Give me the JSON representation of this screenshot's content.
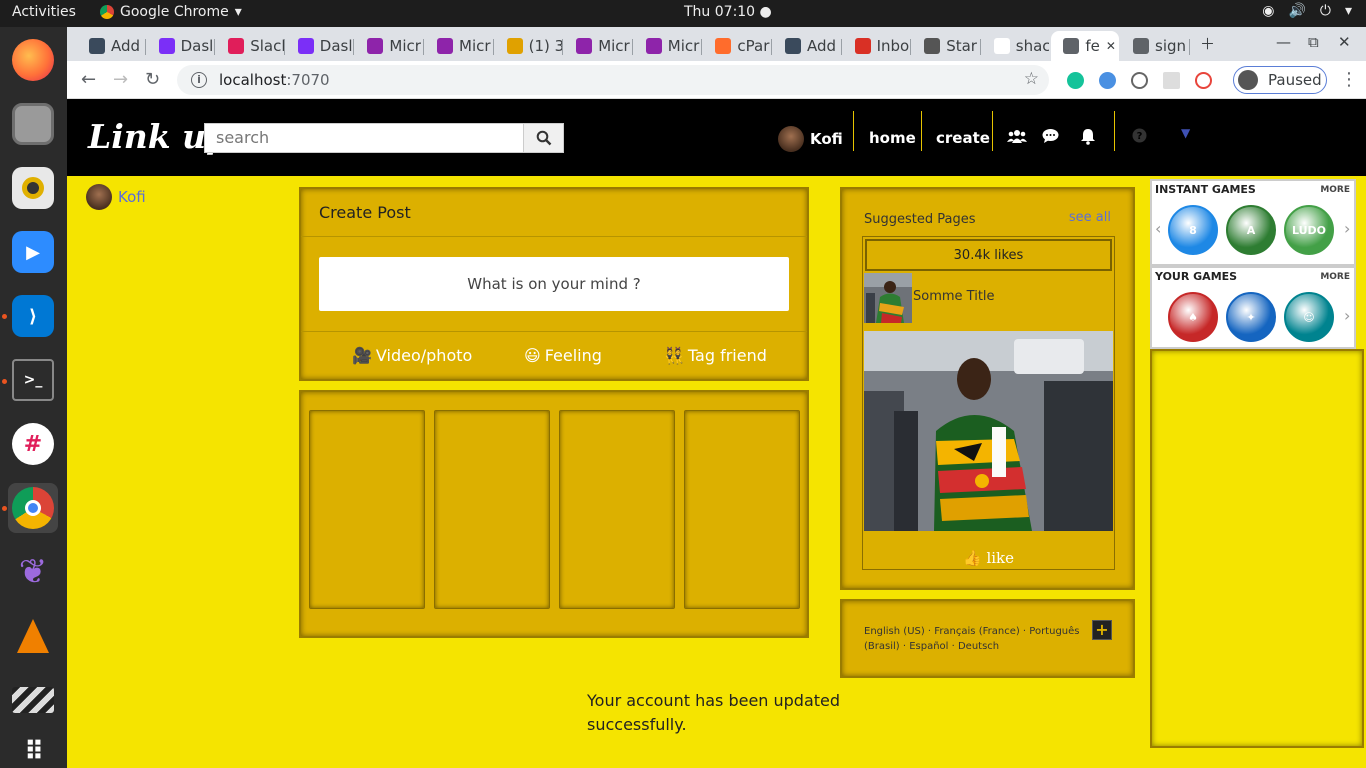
{
  "system": {
    "activities": "Activities",
    "app_name": "Google Chrome",
    "clock": "Thu 07:10"
  },
  "browser": {
    "tabs": [
      {
        "label": "Add",
        "color": "#3a4a5c"
      },
      {
        "label": "Dasl",
        "color": "#7b2ff7"
      },
      {
        "label": "Slacl",
        "color": "#e01e5a"
      },
      {
        "label": "Dasl",
        "color": "#7b2ff7"
      },
      {
        "label": "Micr",
        "color": "#8e24aa"
      },
      {
        "label": "Micr",
        "color": "#8e24aa"
      },
      {
        "label": "(1) 3",
        "color": "#e0a100"
      },
      {
        "label": "Micr",
        "color": "#8e24aa"
      },
      {
        "label": "Micr",
        "color": "#8e24aa"
      },
      {
        "label": "cPar",
        "color": "#ff6c2c"
      },
      {
        "label": "Add",
        "color": "#3a4a5c"
      },
      {
        "label": "Inbo",
        "color": "#d93025"
      },
      {
        "label": "Star",
        "color": "#555555"
      },
      {
        "label": "shac",
        "color": "#ffffff"
      },
      {
        "label": "fe",
        "color": "#5f6368"
      },
      {
        "label": "sign",
        "color": "#5f6368"
      }
    ],
    "active_tab_index": 14,
    "url_host": "localhost",
    "url_port": ":7070",
    "profile_label": "Paused"
  },
  "site": {
    "logo": "Link up",
    "search_placeholder": "search",
    "user_name": "Kofi",
    "nav_home": "home",
    "nav_create": "create"
  },
  "left": {
    "user_name": "Kofi"
  },
  "create_post": {
    "title": "Create Post",
    "placeholder": "What is on your mind ?",
    "actions": {
      "video": "Video/photo",
      "feeling": "Feeling",
      "tag": "Tag friend"
    }
  },
  "suggested": {
    "title": "Suggested Pages",
    "see_all": "see all",
    "likes": "30.4k likes",
    "page_title": "Somme Title",
    "like_label": "like"
  },
  "footer": {
    "languages": "English (US) · Français (France) · Português (Brasil) · Español · Deutsch"
  },
  "status_message": "Your account has been updated successfully.",
  "games": {
    "instant_title": "INSTANT GAMES",
    "your_title": "YOUR GAMES",
    "more": "MORE",
    "instant": [
      {
        "label": "8",
        "color": "#1e88e5"
      },
      {
        "label": "A",
        "color": "#2e7d32"
      },
      {
        "label": "LUDO",
        "color": "#43a047"
      }
    ],
    "yours": [
      {
        "label": "♠",
        "color": "#c62828"
      },
      {
        "label": "✦",
        "color": "#1565c0"
      },
      {
        "label": "☺",
        "color": "#00838f"
      }
    ]
  }
}
